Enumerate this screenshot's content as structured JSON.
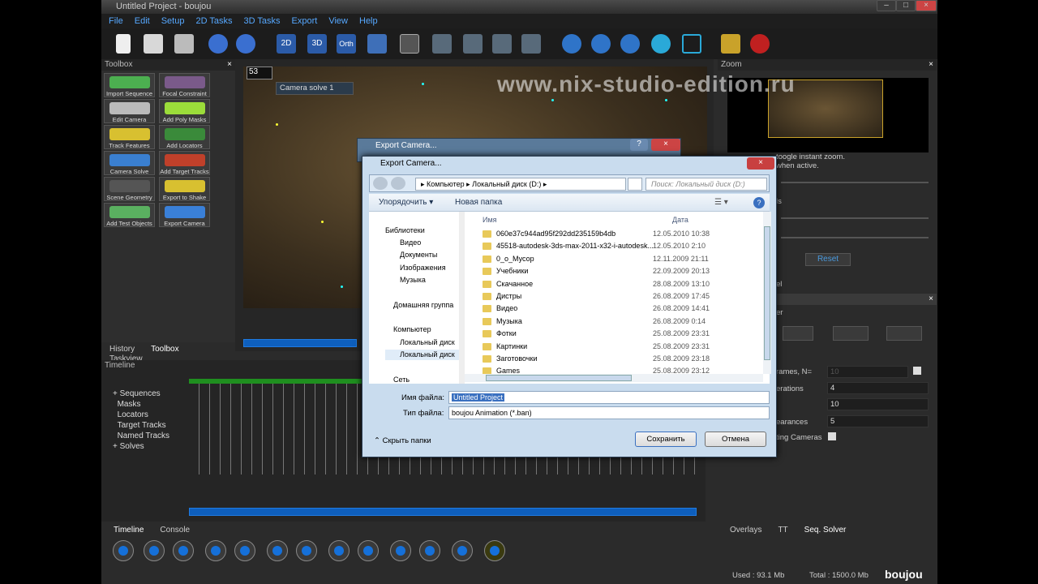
{
  "app": {
    "title": "Untitled Project - boujou",
    "logo": "boujou"
  },
  "menu": [
    "File",
    "Edit",
    "Setup",
    "2D Tasks",
    "3D Tasks",
    "Export",
    "View",
    "Help"
  ],
  "toolbar": {
    "icons": [
      "new-icon",
      "open-icon",
      "save-icon",
      "undo-icon",
      "redo-icon",
      "2d-view-icon",
      "3d-view-icon",
      "ortho-view-icon",
      "graph-view-icon",
      "grid-view-icon"
    ],
    "labels": {
      "v2d": "2D",
      "v3d": "3D",
      "ortho": "Orth"
    }
  },
  "toolbox": {
    "title": "Toolbox",
    "tools": [
      "Import Sequence",
      "Focal Constraint",
      "Edit Camera",
      "Add Poly Masks",
      "Track Features",
      "Add Locators",
      "Camera Solve",
      "Add Target Tracks",
      "Scene Geometry",
      "Export to Shake",
      "Add Test Objects",
      "Export Camera"
    ],
    "tabs": [
      "History",
      "Toolbox",
      "Taskview"
    ]
  },
  "viewport": {
    "frame": "53",
    "camera": "Camera solve 1",
    "watermark": "www.nix-studio-edition.ru"
  },
  "timeline": {
    "title": "Timeline",
    "items": [
      "Sequences",
      "Masks",
      "Locators",
      "Target Tracks",
      "Named Tracks",
      "Solves"
    ],
    "tabs": [
      "Timeline",
      "Console"
    ]
  },
  "zoom": {
    "title": "Zoom",
    "hint1": "toogle instant zoom.",
    "hint2": "when active.",
    "reset": "Reset",
    "frag_ls": "ls",
    "frag_el": "el",
    "frag_er": "er"
  },
  "solver": {
    "frames_label": "rames, N=",
    "frames_val": "10",
    "iterations_label": "erations",
    "iterations_val": "4",
    "val10": "10",
    "appearances_label": "earances",
    "appearances_val": "5",
    "cameras_label": "ting Cameras",
    "tabs": [
      "Overlays",
      "TT",
      "Seq. Solver"
    ]
  },
  "status": {
    "used": "Used : 93.1 Mb",
    "total": "Total : 1500.0 Mb"
  },
  "dialog_back": {
    "title": "Export Camera..."
  },
  "dialog": {
    "title": "Export Camera...",
    "breadcrumb": [
      "Компьютер",
      "Локальный диск (D:)"
    ],
    "search_placeholder": "Поиск: Локальный диск (D:)",
    "organize": "Упорядочить",
    "new_folder": "Новая папка",
    "nav": [
      {
        "label": "Библиотеки",
        "indent": 0
      },
      {
        "label": "Видео",
        "indent": 1
      },
      {
        "label": "Документы",
        "indent": 1
      },
      {
        "label": "Изображения",
        "indent": 1
      },
      {
        "label": "Музыка",
        "indent": 1
      },
      {
        "label": "Домашняя группа",
        "indent": 0
      },
      {
        "label": "Компьютер",
        "indent": 0
      },
      {
        "label": "Локальный диск",
        "indent": 1
      },
      {
        "label": "Локальный диск",
        "indent": 1
      },
      {
        "label": "Сеть",
        "indent": 0
      }
    ],
    "col_name": "Имя",
    "col_date": "Дата",
    "files": [
      {
        "name": "060e37c944ad95f292dd235159b4db",
        "date": "12.05.2010 10:38"
      },
      {
        "name": "45518-autodesk-3ds-max-2011-x32-i-autodesk...",
        "date": "12.05.2010 2:10"
      },
      {
        "name": "0_o_Мусор",
        "date": "12.11.2009 21:11"
      },
      {
        "name": "Учебники",
        "date": "22.09.2009 20:13"
      },
      {
        "name": "Скачанное",
        "date": "28.08.2009 13:10"
      },
      {
        "name": "Дистры",
        "date": "26.08.2009 17:45"
      },
      {
        "name": "Видео",
        "date": "26.08.2009 14:41"
      },
      {
        "name": "Музыка",
        "date": "26.08.2009 0:14"
      },
      {
        "name": "Фотки",
        "date": "25.08.2009 23:31"
      },
      {
        "name": "Картинки",
        "date": "25.08.2009 23:31"
      },
      {
        "name": "Заготовочки",
        "date": "25.08.2009 23:18"
      },
      {
        "name": "Games",
        "date": "25.08.2009 23:12"
      }
    ],
    "filename_label": "Имя файла:",
    "filename_value": "Untitled Project",
    "filetype_label": "Тип файла:",
    "filetype_value": "boujou Animation (*.ban)",
    "hide_folders": "Скрыть папки",
    "save": "Сохранить",
    "cancel": "Отмена"
  },
  "colors": {
    "accent": "#1570d9",
    "menu": "#56a8ff",
    "green": "#1f8f1f"
  }
}
